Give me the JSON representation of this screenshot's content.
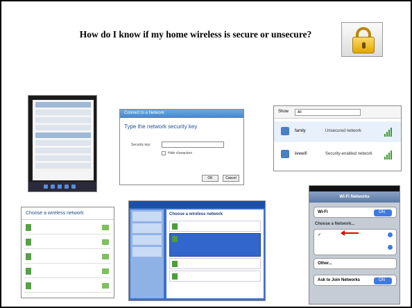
{
  "slide": {
    "title": "How do I know if my home wireless is secure or unsecure?"
  },
  "images": {
    "lock_icon": "lock-icon",
    "taskbar_network_list": {
      "label": "Currently connected to:"
    },
    "connect_to_network": {
      "titlebar": "Connect to a Network",
      "heading": "Type the network security key",
      "key_label": "Security key:",
      "hide_characters": "Hide characters",
      "ok": "OK",
      "cancel": "Cancel"
    },
    "network_list": {
      "show_label": "Show",
      "show_value": "All",
      "rows": [
        {
          "name": "family",
          "status": "Unsecured network"
        },
        {
          "name": "livewifi",
          "status": "Security-enabled network"
        }
      ]
    },
    "choose_network_vista": {
      "heading": "Choose a wireless network"
    },
    "choose_network_xp": {
      "heading": "Choose a wireless network"
    },
    "iphone_wifi": {
      "nav_title": "Wi-Fi Networks",
      "wifi_label": "Wi-Fi",
      "wifi_toggle": "ON",
      "choose_label": "Choose a Network...",
      "other_label": "Other...",
      "ask_label": "Ask to Join Networks",
      "ask_toggle": "ON"
    }
  }
}
